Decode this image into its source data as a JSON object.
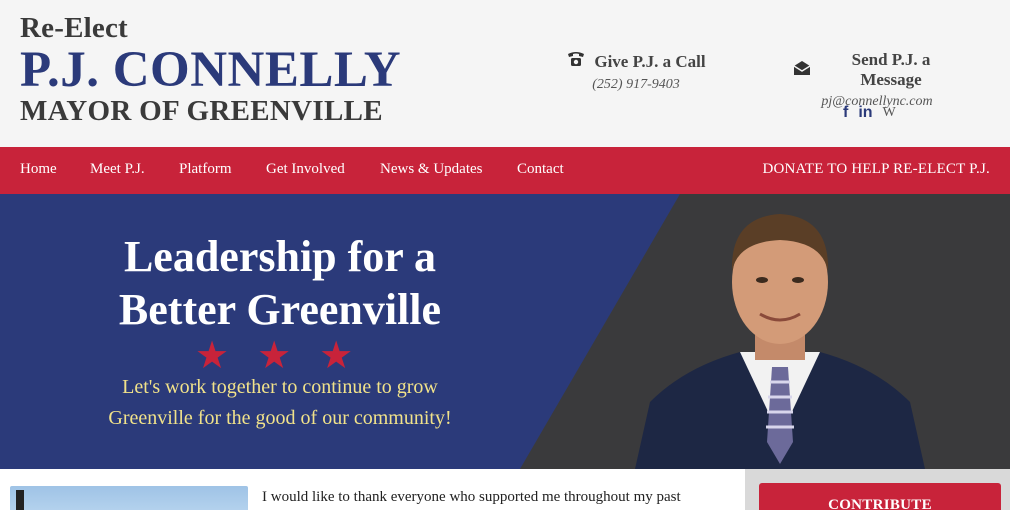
{
  "header": {
    "reelect": "Re-Elect",
    "name": "P.J. CONNELLY",
    "office": "MAYOR OF GREENVILLE",
    "call_title": "Give P.J. a Call",
    "call_phone": "(252) 917-9403",
    "call_icon": "phone-icon",
    "message_title": "Send P.J. a Message",
    "message_email": "pj@connellync.com",
    "message_icon": "envelope-icon",
    "social": {
      "facebook": "f",
      "linkedin": "in",
      "wikipedia": "W"
    }
  },
  "nav": {
    "items": [
      "Home",
      "Meet P.J.",
      "Platform",
      "Get Involved",
      "News & Updates",
      "Contact"
    ],
    "donate": "DONATE TO HELP RE-ELECT P.J."
  },
  "hero": {
    "headline_line1": "Leadership for a",
    "headline_line2": "Better Greenville",
    "stars": [
      "★",
      "★",
      "★"
    ],
    "sub_line1": "Let's work together to continue to grow",
    "sub_line2": "Greenville for the good of our community!"
  },
  "content": {
    "intro": "I would like to thank everyone who supported me throughout my past",
    "contribute_label": "CONTRIBUTE"
  },
  "colors": {
    "navy": "#2b3a7a",
    "red": "#c8233a",
    "hero_dark": "#3a3a3c",
    "yellow_text": "#f1e28a"
  }
}
